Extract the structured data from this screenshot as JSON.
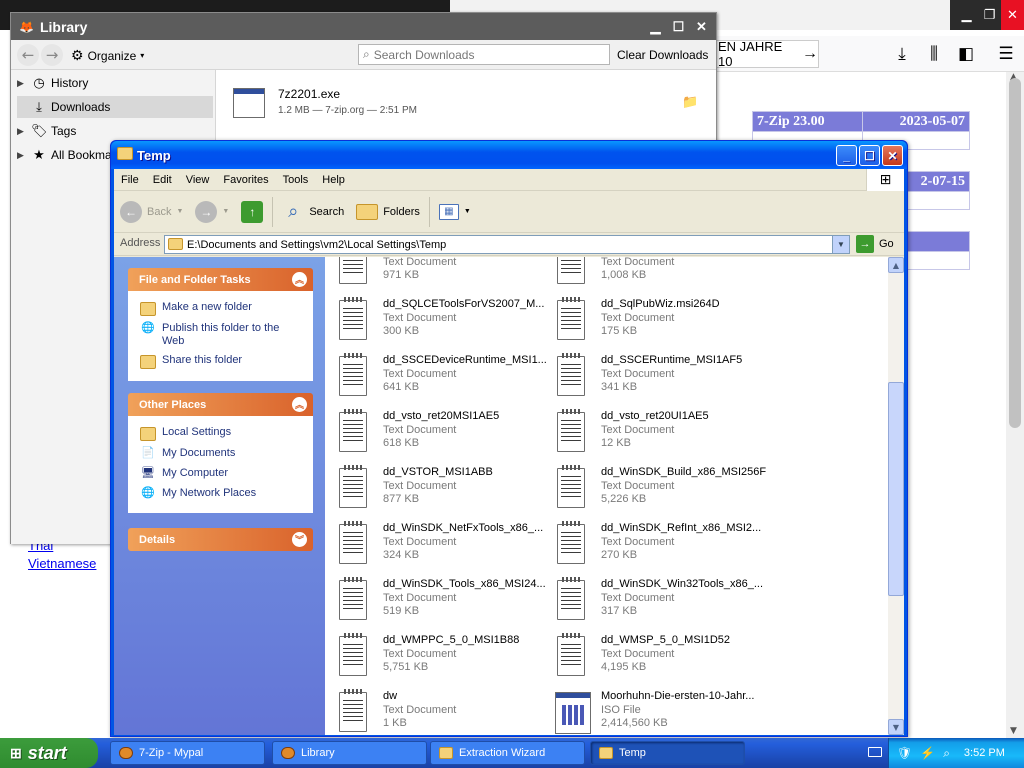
{
  "browser": {
    "url_fragment": "EN JAHRE 10",
    "table": [
      {
        "name": "7-Zip 23.00",
        "date": "2023-05-07"
      },
      {
        "name": "",
        "date": "2-07-15"
      },
      {
        "name": "",
        "date": ""
      }
    ],
    "links": [
      "Thai",
      "Vietnamese"
    ]
  },
  "library": {
    "title": "Library",
    "organize_label": "Organize",
    "search_placeholder": "Search Downloads",
    "clear_label": "Clear Downloads",
    "sidebar": [
      {
        "label": "History",
        "icon": "clock-icon",
        "expandable": true
      },
      {
        "label": "Downloads",
        "icon": "download-icon",
        "expandable": false,
        "selected": true
      },
      {
        "label": "Tags",
        "icon": "tag-icon",
        "expandable": true
      },
      {
        "label": "All Bookmarks",
        "icon": "star-icon",
        "expandable": true
      }
    ],
    "download": {
      "name": "7z2201.exe",
      "meta": "1.2 MB — 7-zip.org — 2:51 PM"
    }
  },
  "temp": {
    "title": "Temp",
    "menu": [
      "File",
      "Edit",
      "View",
      "Favorites",
      "Tools",
      "Help"
    ],
    "toolbar": {
      "back": "Back",
      "search": "Search",
      "folders": "Folders"
    },
    "address_label": "Address",
    "address": "E:\\Documents and Settings\\vm2\\Local Settings\\Temp",
    "go": "Go",
    "panels": {
      "tasks": {
        "title": "File and Folder Tasks",
        "items": [
          "Make a new folder",
          "Publish this folder to the Web",
          "Share this folder"
        ]
      },
      "places": {
        "title": "Other Places",
        "items": [
          "Local Settings",
          "My Documents",
          "My Computer",
          "My Network Places"
        ]
      },
      "details": {
        "title": "Details"
      }
    },
    "files": [
      {
        "name": "",
        "type": "Text Document",
        "size": "971 KB"
      },
      {
        "name": "",
        "type": "Text Document",
        "size": "1,008 KB"
      },
      {
        "name": "dd_SQLCEToolsForVS2007_M...",
        "type": "Text Document",
        "size": "300 KB"
      },
      {
        "name": "dd_SqlPubWiz.msi264D",
        "type": "Text Document",
        "size": "175 KB"
      },
      {
        "name": "dd_SSCEDeviceRuntime_MSI1...",
        "type": "Text Document",
        "size": "641 KB"
      },
      {
        "name": "dd_SSCERuntime_MSI1AF5",
        "type": "Text Document",
        "size": "341 KB"
      },
      {
        "name": "dd_vsto_ret20MSI1AE5",
        "type": "Text Document",
        "size": "618 KB"
      },
      {
        "name": "dd_vsto_ret20UI1AE5",
        "type": "Text Document",
        "size": "12 KB"
      },
      {
        "name": "dd_VSTOR_MSI1ABB",
        "type": "Text Document",
        "size": "877 KB"
      },
      {
        "name": "dd_WinSDK_Build_x86_MSI256F",
        "type": "Text Document",
        "size": "5,226 KB"
      },
      {
        "name": "dd_WinSDK_NetFxTools_x86_...",
        "type": "Text Document",
        "size": "324 KB"
      },
      {
        "name": "dd_WinSDK_RefInt_x86_MSI2...",
        "type": "Text Document",
        "size": "270 KB"
      },
      {
        "name": "dd_WinSDK_Tools_x86_MSI24...",
        "type": "Text Document",
        "size": "519 KB"
      },
      {
        "name": "dd_WinSDK_Win32Tools_x86_...",
        "type": "Text Document",
        "size": "317 KB"
      },
      {
        "name": "dd_WMPPC_5_0_MSI1B88",
        "type": "Text Document",
        "size": "5,751 KB"
      },
      {
        "name": "dd_WMSP_5_0_MSI1D52",
        "type": "Text Document",
        "size": "4,195 KB"
      },
      {
        "name": "dw",
        "type": "Text Document",
        "size": "1 KB"
      },
      {
        "name": "Moorhuhn-Die-ersten-10-Jahr...",
        "type": "ISO File",
        "size": "2,414,560 KB"
      }
    ]
  },
  "taskbar": {
    "start": "start",
    "tasks": [
      "7-Zip - Mypal",
      "Library",
      "Extraction Wizard",
      "Temp"
    ],
    "clock": "3:52 PM"
  }
}
